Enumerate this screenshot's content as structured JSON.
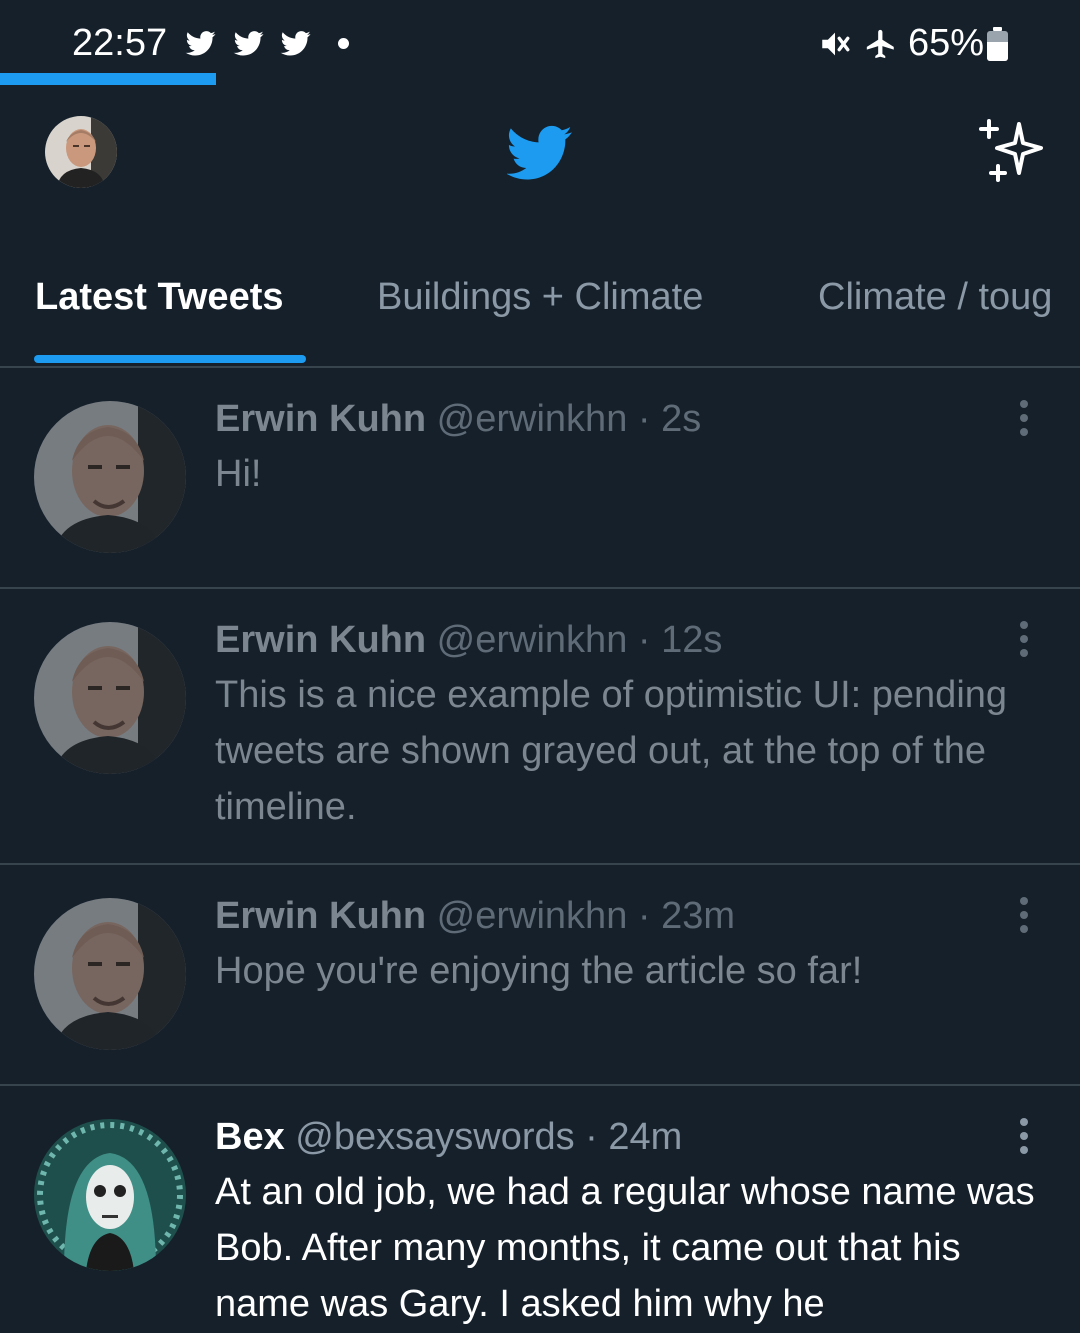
{
  "status_bar": {
    "time": "22:57",
    "notification_icons": [
      "twitter-bird-icon",
      "twitter-bird-icon",
      "twitter-bird-icon"
    ],
    "icons": [
      "mute-icon",
      "airplane-mode-icon",
      "battery-icon"
    ],
    "battery_percent": "65%",
    "battery_level": 0.65,
    "load_progress": 0.2
  },
  "header": {
    "logo": "twitter-bird-icon",
    "right_icon": "sparkle-icon"
  },
  "tabs": [
    {
      "label": "Latest Tweets",
      "active": true
    },
    {
      "label": "Buildings + Climate",
      "active": false
    },
    {
      "label": "Climate / toug",
      "active": false
    }
  ],
  "tweets": [
    {
      "name": "Erwin Kuhn",
      "meta": "@erwinkhn · 2s",
      "text": "Hi!",
      "pending": true
    },
    {
      "name": "Erwin Kuhn",
      "meta": "@erwinkhn · 12s",
      "text": "This is a nice example of optimistic UI: pending tweets are shown grayed out, at the top of the timeline.",
      "pending": true
    },
    {
      "name": "Erwin Kuhn",
      "meta": "@erwinkhn · 23m",
      "text": "Hope you're enjoying the article so far!",
      "pending": true
    },
    {
      "name": "Bex",
      "meta": "@bexsayswords · 24m",
      "text": "At an old job, we had a regular whose name was Bob. After many months, it came out that his name was Gary. I asked him why he",
      "pending": false
    }
  ],
  "colors": {
    "background": "#15202b",
    "accent": "#1d9bf0",
    "divider": "#38444d",
    "muted_text": "#8b98a5"
  }
}
